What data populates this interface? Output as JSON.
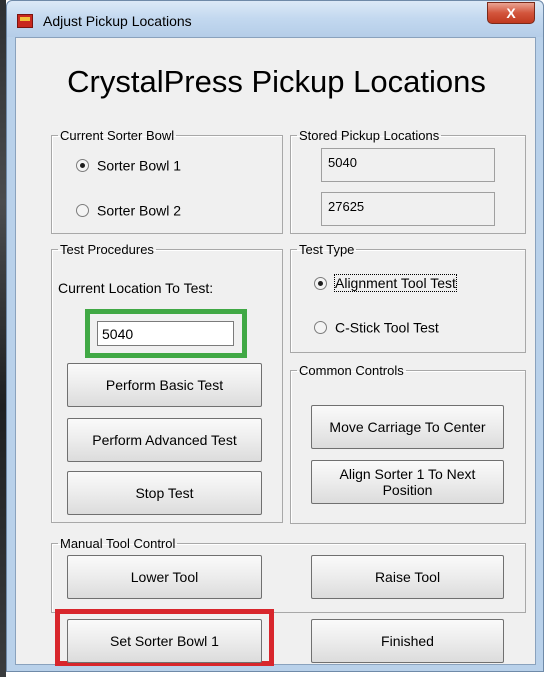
{
  "window": {
    "title": "Adjust Pickup Locations",
    "close_label": "X"
  },
  "heading": "CrystalPress Pickup Locations",
  "current_sorter_bowl": {
    "legend": "Current Sorter Bowl",
    "options": [
      {
        "label": "Sorter Bowl 1",
        "checked": true
      },
      {
        "label": "Sorter Bowl 2",
        "checked": false
      }
    ]
  },
  "stored_pickup_locations": {
    "legend": "Stored Pickup Locations",
    "values": [
      "5040",
      "27625"
    ]
  },
  "test_procedures": {
    "legend": "Test Procedures",
    "current_location_label": "Current Location To Test:",
    "current_location_value": "5040",
    "buttons": [
      "Perform Basic Test",
      "Perform Advanced Test",
      "Stop Test"
    ]
  },
  "test_type": {
    "legend": "Test Type",
    "options": [
      {
        "label": "Alignment Tool Test",
        "checked": true
      },
      {
        "label": "C-Stick Tool Test",
        "checked": false
      }
    ]
  },
  "common_controls": {
    "legend": "Common Controls",
    "buttons": [
      "Move Carriage To Center",
      "Align Sorter 1 To Next\nPosition"
    ]
  },
  "manual_tool_control": {
    "legend": "Manual Tool Control",
    "buttons": [
      "Lower Tool",
      "Raise Tool"
    ]
  },
  "footer": {
    "set_bowl_label": "Set Sorter Bowl 1",
    "finished_label": "Finished"
  },
  "colors": {
    "highlight_green": "#40a845",
    "highlight_red": "#d8262c",
    "title_bar": "#c2d8ef",
    "close_button": "#c0391f"
  }
}
